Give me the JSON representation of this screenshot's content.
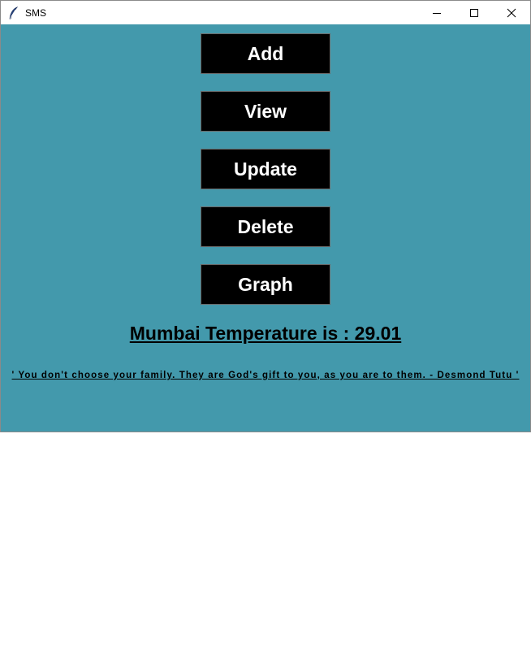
{
  "window": {
    "title": "SMS",
    "app_icon": "feather-icon",
    "controls": [
      "minimize-icon",
      "maximize-icon",
      "close-icon"
    ]
  },
  "buttons": {
    "add": "Add",
    "view": "View",
    "update": "Update",
    "delete": "Delete",
    "graph": "Graph"
  },
  "temperature_text": "Mumbai Temperature is : 29.01",
  "quote_text": "' You don't choose your family. They are God's gift to you, as you are to them. - Desmond Tutu '",
  "colors": {
    "background": "#4399ac",
    "button_bg": "#000000",
    "button_text": "#ffffff"
  }
}
